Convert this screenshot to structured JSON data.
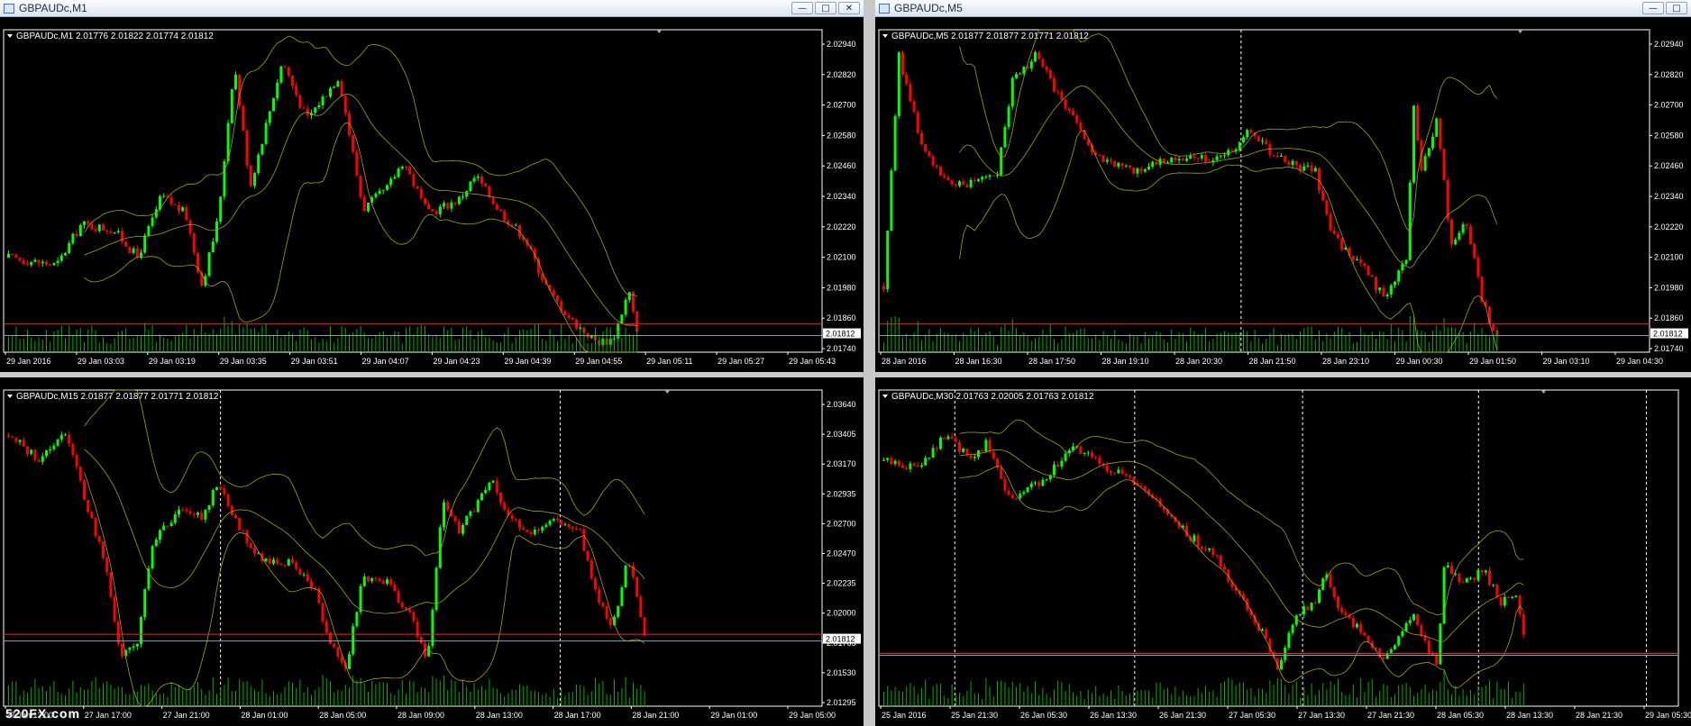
{
  "colors": {
    "up": "#00ff00",
    "down": "#ff0000",
    "band": "#a5a500",
    "axis": "#ffffff",
    "bid": "#ff2020",
    "ask": "#8aa0b8",
    "volume": "#00b000",
    "grid": "#ffffff"
  },
  "windows": [
    {
      "title": "GBPAUDc,M1",
      "header": "GBPAUDc,M1  2.01776 2.01822 2.01774 2.01812",
      "price_labels": [
        "2.02940",
        "2.02820",
        "2.02700",
        "2.02580",
        "2.02460",
        "2.02340",
        "2.02220",
        "2.02100",
        "2.01980",
        "2.01860",
        "2.01740"
      ],
      "current_price": "2.01812",
      "time_labels": [
        "29 Jan 2016",
        "29 Jan 03:03",
        "29 Jan 03:19",
        "29 Jan 03:35",
        "29 Jan 03:51",
        "29 Jan 04:07",
        "29 Jan 04:23",
        "29 Jan 04:39",
        "29 Jan 04:55",
        "29 Jan 05:11",
        "29 Jan 05:27",
        "29 Jan 05:43"
      ],
      "ylim": [
        2.0174,
        2.0298
      ],
      "path": [
        [
          0,
          2.0211
        ],
        [
          0.06,
          2.0208
        ],
        [
          0.09,
          2.0224
        ],
        [
          0.13,
          2.0222
        ],
        [
          0.16,
          2.0211
        ],
        [
          0.19,
          2.0235
        ],
        [
          0.22,
          2.0228
        ],
        [
          0.24,
          2.02
        ],
        [
          0.26,
          2.0226
        ],
        [
          0.28,
          2.0287
        ],
        [
          0.3,
          2.0239
        ],
        [
          0.34,
          2.0288
        ],
        [
          0.37,
          2.0265
        ],
        [
          0.41,
          2.0282
        ],
        [
          0.44,
          2.023
        ],
        [
          0.47,
          2.0238
        ],
        [
          0.49,
          2.0249
        ],
        [
          0.52,
          2.0228
        ],
        [
          0.56,
          2.0234
        ],
        [
          0.58,
          2.0243
        ],
        [
          0.61,
          2.0229
        ],
        [
          0.64,
          2.0219
        ],
        [
          0.67,
          2.0198
        ],
        [
          0.7,
          2.0186
        ],
        [
          0.73,
          2.0178
        ],
        [
          0.75,
          2.0179
        ],
        [
          0.77,
          2.0198
        ],
        [
          0.78,
          2.0181
        ]
      ],
      "data_end": 0.78,
      "vlines": [],
      "bid_level": 2.0185,
      "ask_level": 2.01812
    },
    {
      "title": "GBPAUDc,M5",
      "header": "GBPAUDc,M5  2.01877 2.01877 2.01771 2.01812",
      "price_labels": [
        "2.02940",
        "2.02820",
        "2.02700",
        "2.02580",
        "2.02460",
        "2.02340",
        "2.02220",
        "2.02100",
        "2.01980",
        "2.01860",
        "2.01740"
      ],
      "current_price": "2.01812",
      "time_labels": [
        "28 Jan 2016",
        "28 Jan 16:30",
        "28 Jan 17:50",
        "28 Jan 19:10",
        "28 Jan 20:30",
        "28 Jan 21:50",
        "28 Jan 23:10",
        "29 Jan 00:30",
        "29 Jan 01:50",
        "29 Jan 03:10",
        "29 Jan 04:30"
      ],
      "ylim": [
        2.0174,
        2.0298
      ],
      "path": [
        [
          0,
          2.02
        ],
        [
          0.02,
          2.029
        ],
        [
          0.05,
          2.0255
        ],
        [
          0.09,
          2.0238
        ],
        [
          0.15,
          2.0245
        ],
        [
          0.17,
          2.028
        ],
        [
          0.2,
          2.029
        ],
        [
          0.24,
          2.027
        ],
        [
          0.28,
          2.025
        ],
        [
          0.33,
          2.0245
        ],
        [
          0.38,
          2.025
        ],
        [
          0.45,
          2.025
        ],
        [
          0.48,
          2.026
        ],
        [
          0.53,
          2.0248
        ],
        [
          0.57,
          2.0245
        ],
        [
          0.59,
          2.022
        ],
        [
          0.63,
          2.0208
        ],
        [
          0.66,
          2.0196
        ],
        [
          0.69,
          2.021
        ],
        [
          0.7,
          2.027
        ],
        [
          0.71,
          2.0245
        ],
        [
          0.73,
          2.0265
        ],
        [
          0.75,
          2.0215
        ],
        [
          0.77,
          2.0225
        ],
        [
          0.79,
          2.0195
        ],
        [
          0.8,
          2.0185
        ],
        [
          0.81,
          2.0181
        ]
      ],
      "data_end": 0.81,
      "vlines": [
        0.47
      ],
      "bid_level": 2.0185,
      "ask_level": 2.01812
    },
    {
      "title": "",
      "header": "GBPAUDc,M15  2.01877 2.01877 2.01771 2.01812",
      "price_labels": [
        "2.03640",
        "2.03405",
        "2.03170",
        "2.02935",
        "2.02700",
        "2.02470",
        "2.02235",
        "2.02000",
        "2.01765",
        "2.01530",
        "2.01295"
      ],
      "current_price": "2.01812",
      "time_labels": [
        "27 Jan 13:00",
        "27 Jan 17:00",
        "27 Jan 21:00",
        "28 Jan 01:00",
        "28 Jan 05:00",
        "28 Jan 09:00",
        "28 Jan 13:00",
        "28 Jan 17:00",
        "28 Jan 21:00",
        "29 Jan 01:00",
        "29 Jan 05:00"
      ],
      "ylim": [
        2.0129,
        2.0371
      ],
      "path": [
        [
          0,
          2.034
        ],
        [
          0.04,
          2.032
        ],
        [
          0.07,
          2.0345
        ],
        [
          0.1,
          2.028
        ],
        [
          0.12,
          2.024
        ],
        [
          0.14,
          2.0165
        ],
        [
          0.16,
          2.018
        ],
        [
          0.18,
          2.026
        ],
        [
          0.2,
          2.027
        ],
        [
          0.22,
          2.0285
        ],
        [
          0.24,
          2.0275
        ],
        [
          0.26,
          2.0305
        ],
        [
          0.28,
          2.0275
        ],
        [
          0.31,
          2.0245
        ],
        [
          0.35,
          2.024
        ],
        [
          0.38,
          2.022
        ],
        [
          0.4,
          2.0175
        ],
        [
          0.42,
          2.016
        ],
        [
          0.44,
          2.023
        ],
        [
          0.47,
          2.0225
        ],
        [
          0.5,
          2.02
        ],
        [
          0.52,
          2.0165
        ],
        [
          0.54,
          2.029
        ],
        [
          0.56,
          2.0265
        ],
        [
          0.6,
          2.0305
        ],
        [
          0.62,
          2.0275
        ],
        [
          0.65,
          2.0265
        ],
        [
          0.68,
          2.0275
        ],
        [
          0.71,
          2.0265
        ],
        [
          0.73,
          2.0215
        ],
        [
          0.75,
          2.019
        ],
        [
          0.77,
          2.0245
        ],
        [
          0.79,
          2.0181
        ]
      ],
      "data_end": 0.79,
      "vlines": [
        0.265,
        0.68
      ],
      "bid_level": 2.0185,
      "ask_level": 2.01812
    },
    {
      "title": "",
      "header": "GBPAUDc,M30  2.01763 2.02005 2.01763 2.01812",
      "price_labels": [],
      "current_price": "",
      "time_labels": [
        "25 Jan 2016",
        "25 Jan 21:30",
        "26 Jan 05:30",
        "26 Jan 13:30",
        "26 Jan 21:30",
        "27 Jan 05:30",
        "27 Jan 13:30",
        "27 Jan 21:30",
        "28 Jan 05:30",
        "28 Jan 13:30",
        "28 Jan 21:30",
        "29 Jan 05:30"
      ],
      "ylim": [
        2.0129,
        2.0371
      ],
      "path": [
        [
          0,
          2.032
        ],
        [
          0.04,
          2.0315
        ],
        [
          0.08,
          2.034
        ],
        [
          0.11,
          2.032
        ],
        [
          0.13,
          2.0335
        ],
        [
          0.16,
          2.029
        ],
        [
          0.2,
          2.0305
        ],
        [
          0.24,
          2.033
        ],
        [
          0.3,
          2.031
        ],
        [
          0.34,
          2.029
        ],
        [
          0.38,
          2.0265
        ],
        [
          0.42,
          2.0245
        ],
        [
          0.45,
          2.0215
        ],
        [
          0.48,
          2.0185
        ],
        [
          0.5,
          2.0155
        ],
        [
          0.52,
          2.02
        ],
        [
          0.54,
          2.0205
        ],
        [
          0.56,
          2.023
        ],
        [
          0.58,
          2.02
        ],
        [
          0.61,
          2.0185
        ],
        [
          0.63,
          2.0165
        ],
        [
          0.65,
          2.018
        ],
        [
          0.67,
          2.02
        ],
        [
          0.7,
          2.016
        ],
        [
          0.71,
          2.024
        ],
        [
          0.73,
          2.0225
        ],
        [
          0.76,
          2.0235
        ],
        [
          0.78,
          2.021
        ],
        [
          0.8,
          2.0215
        ],
        [
          0.81,
          2.0181
        ]
      ],
      "data_end": 0.81,
      "vlines": [
        0.095,
        0.32,
        0.53,
        0.75,
        0.96
      ],
      "bid_level": 2.017,
      "ask_level": 2.017
    }
  ],
  "watermark": "520FX.com"
}
